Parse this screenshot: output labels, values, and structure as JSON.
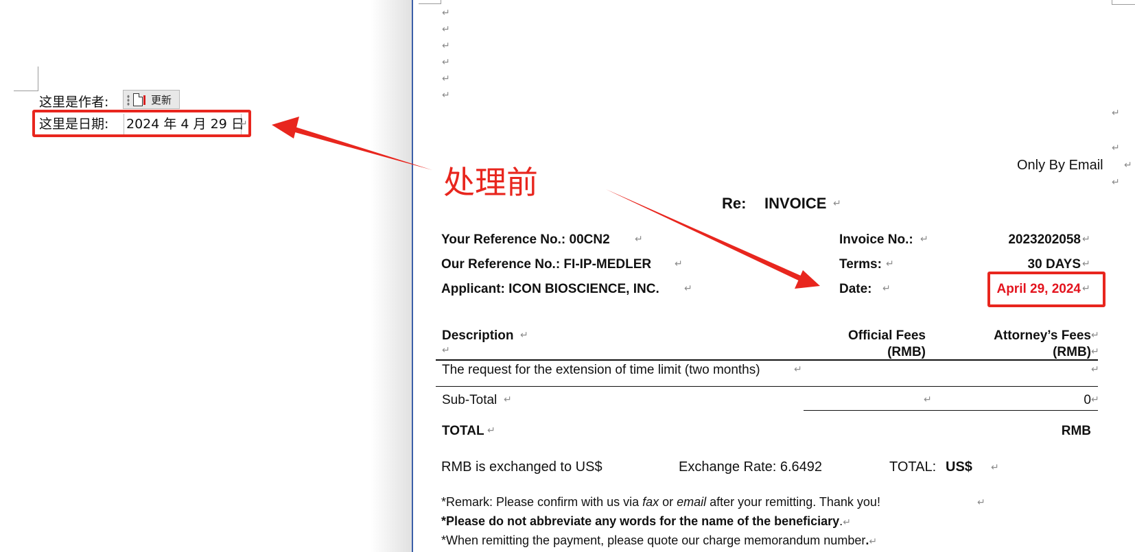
{
  "left_doc": {
    "author_label": "这里是作者:",
    "update_button_label": "更新",
    "date_label": "这里是日期:",
    "date_value": "2024 年 4 月 29 日"
  },
  "annotation": {
    "title": "处理前",
    "color": "#e8261e"
  },
  "paragraph_mark": "↵",
  "invoice": {
    "delivery": "Only By Email",
    "re_label": "Re:",
    "re_value": "INVOICE",
    "your_ref": "Your Reference No.: 00CN2",
    "our_ref": "Our Reference No.: FI-IP-MEDLER",
    "applicant": "Applicant: ICON BIOSCIENCE, INC.",
    "invoice_no_label": "Invoice No.:",
    "invoice_no_value": "2023202058",
    "terms_label": "Terms:",
    "terms_value": "30 DAYS",
    "date_label": "Date:",
    "date_value": "April 29, 2024",
    "date_color": "#e3141e",
    "table": {
      "col_description": "Description",
      "col_official_1": "Official Fees",
      "col_official_2": "(RMB)",
      "col_attorney_1": "Attorney’s Fees",
      "col_attorney_2": "(RMB)",
      "row1": "The request for the extension of time limit (two months)",
      "subtotal_label": "Sub-Total",
      "subtotal_attorney": "0",
      "total_label": "TOTAL",
      "total_currency": "RMB"
    },
    "exchange": {
      "text": "RMB is exchanged to US$",
      "rate": "Exchange Rate: 6.6492",
      "total_label": "TOTAL:",
      "total_currency": "US$"
    },
    "remark_1a": "*Remark: Please confirm with us via ",
    "remark_1_fax": "fax",
    "remark_1b": " or ",
    "remark_1_email": "email",
    "remark_1c": " after your remitting. Thank you!",
    "remark_2_star": "*",
    "remark_2_bold": "Please do not abbreviate any words for the name of the beneficiary",
    "remark_2_end": ".",
    "remark_3": "*When remitting the payment, please quote our charge memorandum number",
    "remark_3_end": "."
  }
}
